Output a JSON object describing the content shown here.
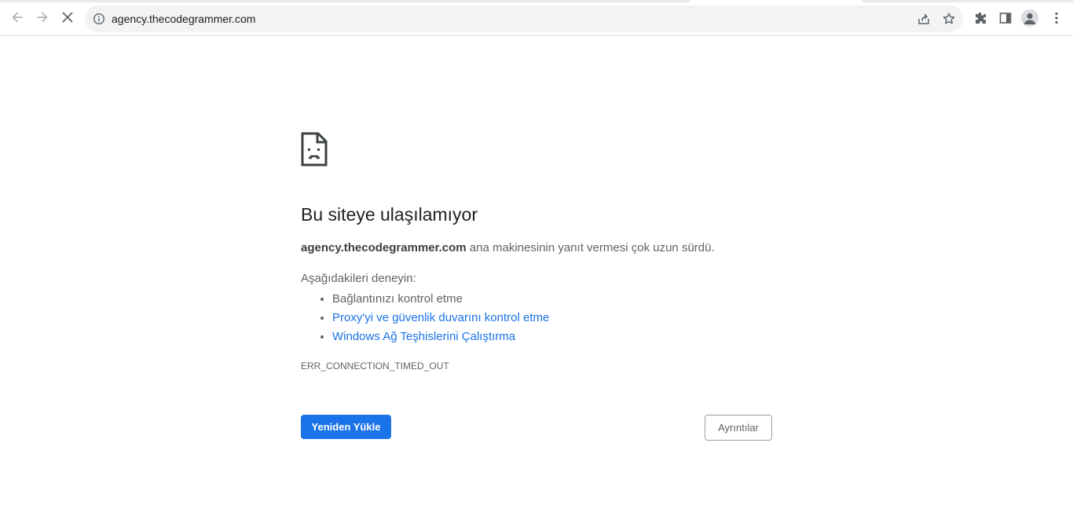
{
  "browser": {
    "url": "agency.thecodegrammer.com",
    "icons": {
      "back": "arrow-left-icon",
      "forward": "arrow-right-icon",
      "stop": "close-icon",
      "site_info": "info-icon",
      "share": "share-icon",
      "bookmark": "star-icon",
      "extensions": "puzzle-icon",
      "side_panel": "side-panel-icon",
      "profile": "avatar-icon",
      "menu": "kebab-menu-icon"
    }
  },
  "error_page": {
    "icon": "sad-page-icon",
    "heading": "Bu siteye ulaşılamıyor",
    "summary_host": "agency.thecodegrammer.com",
    "summary_text": " ana makinesinin yanıt vermesi çok uzun sürdü.",
    "suggestions_title": "Aşağıdakileri deneyin:",
    "suggestions": [
      {
        "label": "Bağlantınızı kontrol etme",
        "link": false
      },
      {
        "label": "Proxy'yi ve güvenlik duvarını kontrol etme",
        "link": true
      },
      {
        "label": "Windows Ağ Teşhislerini Çalıştırma",
        "link": true
      }
    ],
    "error_code": "ERR_CONNECTION_TIMED_OUT",
    "reload_label": "Yeniden Yükle",
    "details_label": "Ayrıntılar"
  },
  "colors": {
    "accent": "#1a73e8",
    "text_primary": "#202124",
    "text_secondary": "#5f6368"
  }
}
